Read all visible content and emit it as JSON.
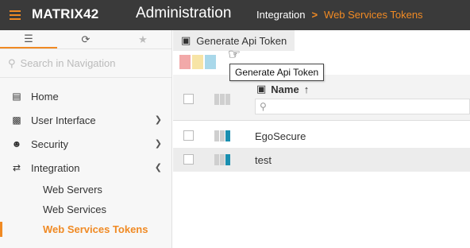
{
  "header": {
    "logo_main": "MATRIX",
    "logo_num": "42",
    "app_title": "Administration",
    "breadcrumb": [
      "Integration",
      "Web Services Tokens"
    ],
    "breadcrumb_sep": ">"
  },
  "sidebar": {
    "search_placeholder": "Search in Navigation",
    "items": [
      {
        "label": "Home",
        "icon": "home-icon"
      },
      {
        "label": "User Interface",
        "icon": "ui-icon"
      },
      {
        "label": "Security",
        "icon": "user-icon"
      },
      {
        "label": "Integration",
        "icon": "integration-icon"
      }
    ],
    "subitems": [
      {
        "label": "Web Servers"
      },
      {
        "label": "Web Services"
      },
      {
        "label": "Web Services Tokens",
        "active": true
      }
    ]
  },
  "toolbar": {
    "generate_label": "Generate Api Token",
    "tooltip": "Generate Api Token"
  },
  "table": {
    "column_name": "Name",
    "sort": "↑",
    "rows": [
      {
        "name": "EgoSecure"
      },
      {
        "name": "test"
      }
    ]
  },
  "colors": {
    "accent": "#f08a24",
    "swatches": [
      "#f2a9a9",
      "#f7e4a6",
      "#a9d8ea"
    ],
    "status_blue": "#1a8fb0"
  }
}
